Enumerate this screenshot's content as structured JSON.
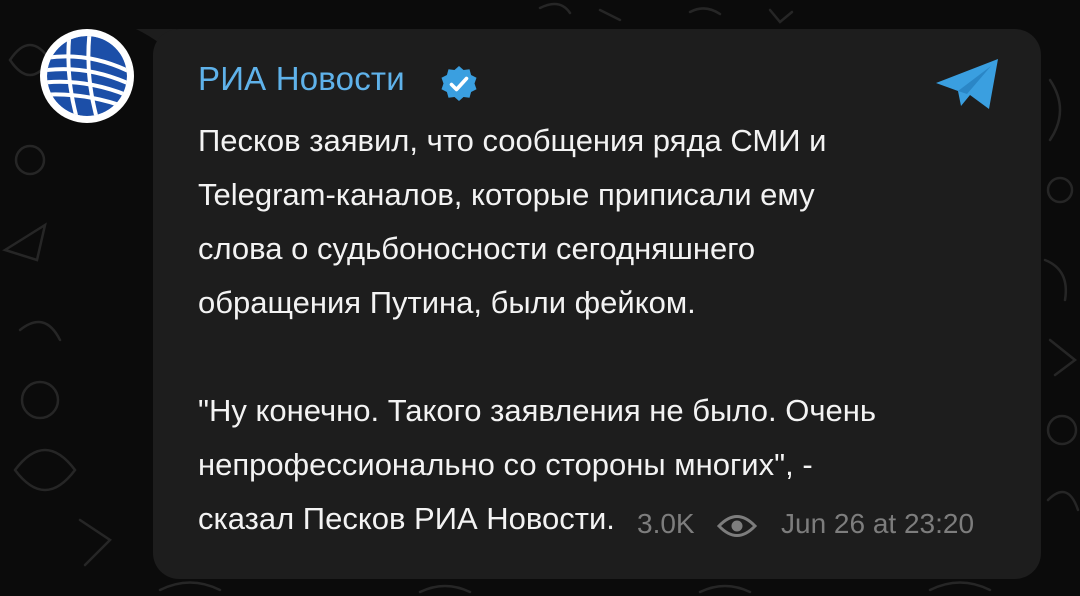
{
  "channel": {
    "name": "РИА Новости",
    "verified": true,
    "accent_color": "#5fb2ea"
  },
  "message": {
    "paragraphs": [
      [
        "Песков заявил, что сообщения ряда СМИ и",
        "Telegram-каналов, которые приписали ему",
        "слова о судьбоносности сегодняшнего",
        "обращения Путина, были фейком."
      ],
      [
        "\"Ну конечно. Такого заявления не было. Очень",
        "непрофессионально со стороны многих\", -",
        "сказал Песков РИА Новости."
      ]
    ]
  },
  "meta": {
    "views": "3.0K",
    "timestamp": "Jun 26 at 23:20"
  },
  "icons": {
    "avatar": "ria-novosti-globe-logo",
    "verified": "verified-badge-icon",
    "platform": "telegram-plane-icon",
    "views": "eye-icon"
  },
  "colors": {
    "background": "#0b0b0b",
    "bubble": "#1d1d1d",
    "text": "#f3f3f3",
    "meta": "#7d7d7d",
    "telegram": "#3a9fe0"
  }
}
